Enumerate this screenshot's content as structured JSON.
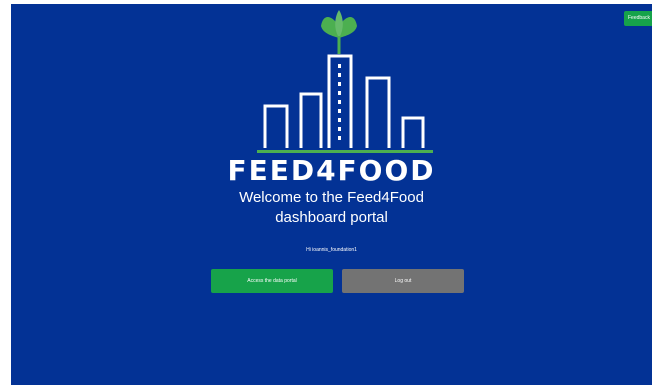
{
  "brand": {
    "name": "FEED4FOOD"
  },
  "welcome": {
    "line1": "Welcome to the Feed4Food",
    "line2": "dashboard portal"
  },
  "greeting": "Hi ioannis_foundation1",
  "actions": {
    "access_label": "Access the data portal",
    "logout_label": "Log out"
  },
  "feedback": {
    "label": "Feedback"
  },
  "colors": {
    "background": "#033295",
    "accent_green": "#17a34a",
    "logout_gray": "#737373",
    "leaf_green": "#4caf50"
  },
  "icons": {
    "logo": "feed4food-city-sprout-logo"
  }
}
